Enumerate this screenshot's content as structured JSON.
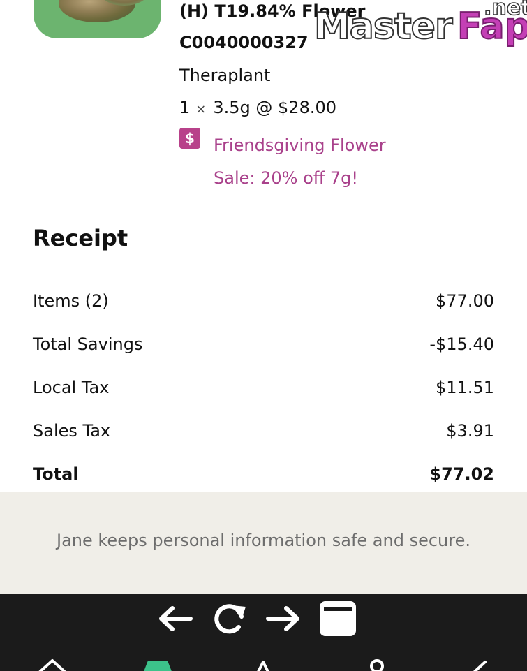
{
  "product": {
    "name": "(H) T19.84% Flower",
    "sku": "C0040000327",
    "brand": "Theraplant",
    "qty": "1",
    "times": "×",
    "size_price": "3.5g @ $28.00",
    "promo_icon": "$",
    "promo_line1": "Friendsgiving Flower",
    "promo_line2": "Sale: 20% off 7g!"
  },
  "receipt": {
    "title": "Receipt",
    "rows": [
      {
        "label": "Items (2)",
        "value": "$77.00"
      },
      {
        "label": "Total Savings",
        "value": "-$15.40"
      },
      {
        "label": "Local Tax",
        "value": "$11.51"
      },
      {
        "label": "Sales Tax",
        "value": "$3.91"
      },
      {
        "label": "Total",
        "value": "$77.02"
      }
    ]
  },
  "footer": {
    "secure_text": "Jane keeps personal information safe and secure."
  },
  "watermark": {
    "master": "Master",
    "fap": "Fap",
    "net": ".net"
  },
  "browser": {
    "back_icon": "arrow-left-icon",
    "reload_icon": "reload-icon",
    "forward_icon": "arrow-right-icon",
    "tabs_icon": "tabs-icon"
  },
  "colors": {
    "promo": "#a9418b",
    "promo_icon_bg": "#b8418a",
    "secure_band": "#f0eee8",
    "toolbar": "#1b1b1b",
    "nav_active": "#3cc28a"
  }
}
